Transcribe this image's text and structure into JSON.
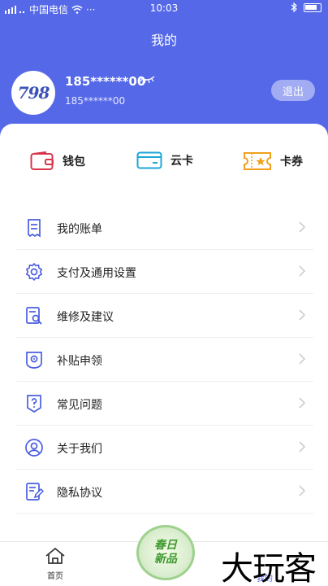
{
  "status_bar": {
    "carrier": "中国电信",
    "time": "10:03"
  },
  "header": {
    "title": "我的"
  },
  "profile": {
    "avatar_text": "798",
    "phone_masked": "185******00",
    "phone_masked_sub": "185******00",
    "logout_label": "退出"
  },
  "quick_actions": [
    {
      "label": "钱包",
      "icon": "wallet-icon"
    },
    {
      "label": "云卡",
      "icon": "card-icon"
    },
    {
      "label": "卡券",
      "icon": "coupon-icon"
    }
  ],
  "menu": [
    {
      "label": "我的账单",
      "icon": "bill-icon"
    },
    {
      "label": "支付及通用设置",
      "icon": "gear-icon"
    },
    {
      "label": "维修及建议",
      "icon": "repair-icon"
    },
    {
      "label": "补贴申领",
      "icon": "subsidy-icon"
    },
    {
      "label": "常见问题",
      "icon": "question-icon"
    },
    {
      "label": "关于我们",
      "icon": "user-icon"
    },
    {
      "label": "隐私协议",
      "icon": "document-edit-icon"
    }
  ],
  "tabbar": {
    "home_label": "首页",
    "mine_label": "我的"
  },
  "promo": {
    "line1": "春日",
    "line2": "新品"
  },
  "watermark": "大玩客",
  "colors": {
    "primary": "#5468e8",
    "wallet": "#d9344a",
    "card": "#1fa7d6",
    "coupon": "#f0a11c",
    "menu_icon": "#4a5ee0"
  }
}
